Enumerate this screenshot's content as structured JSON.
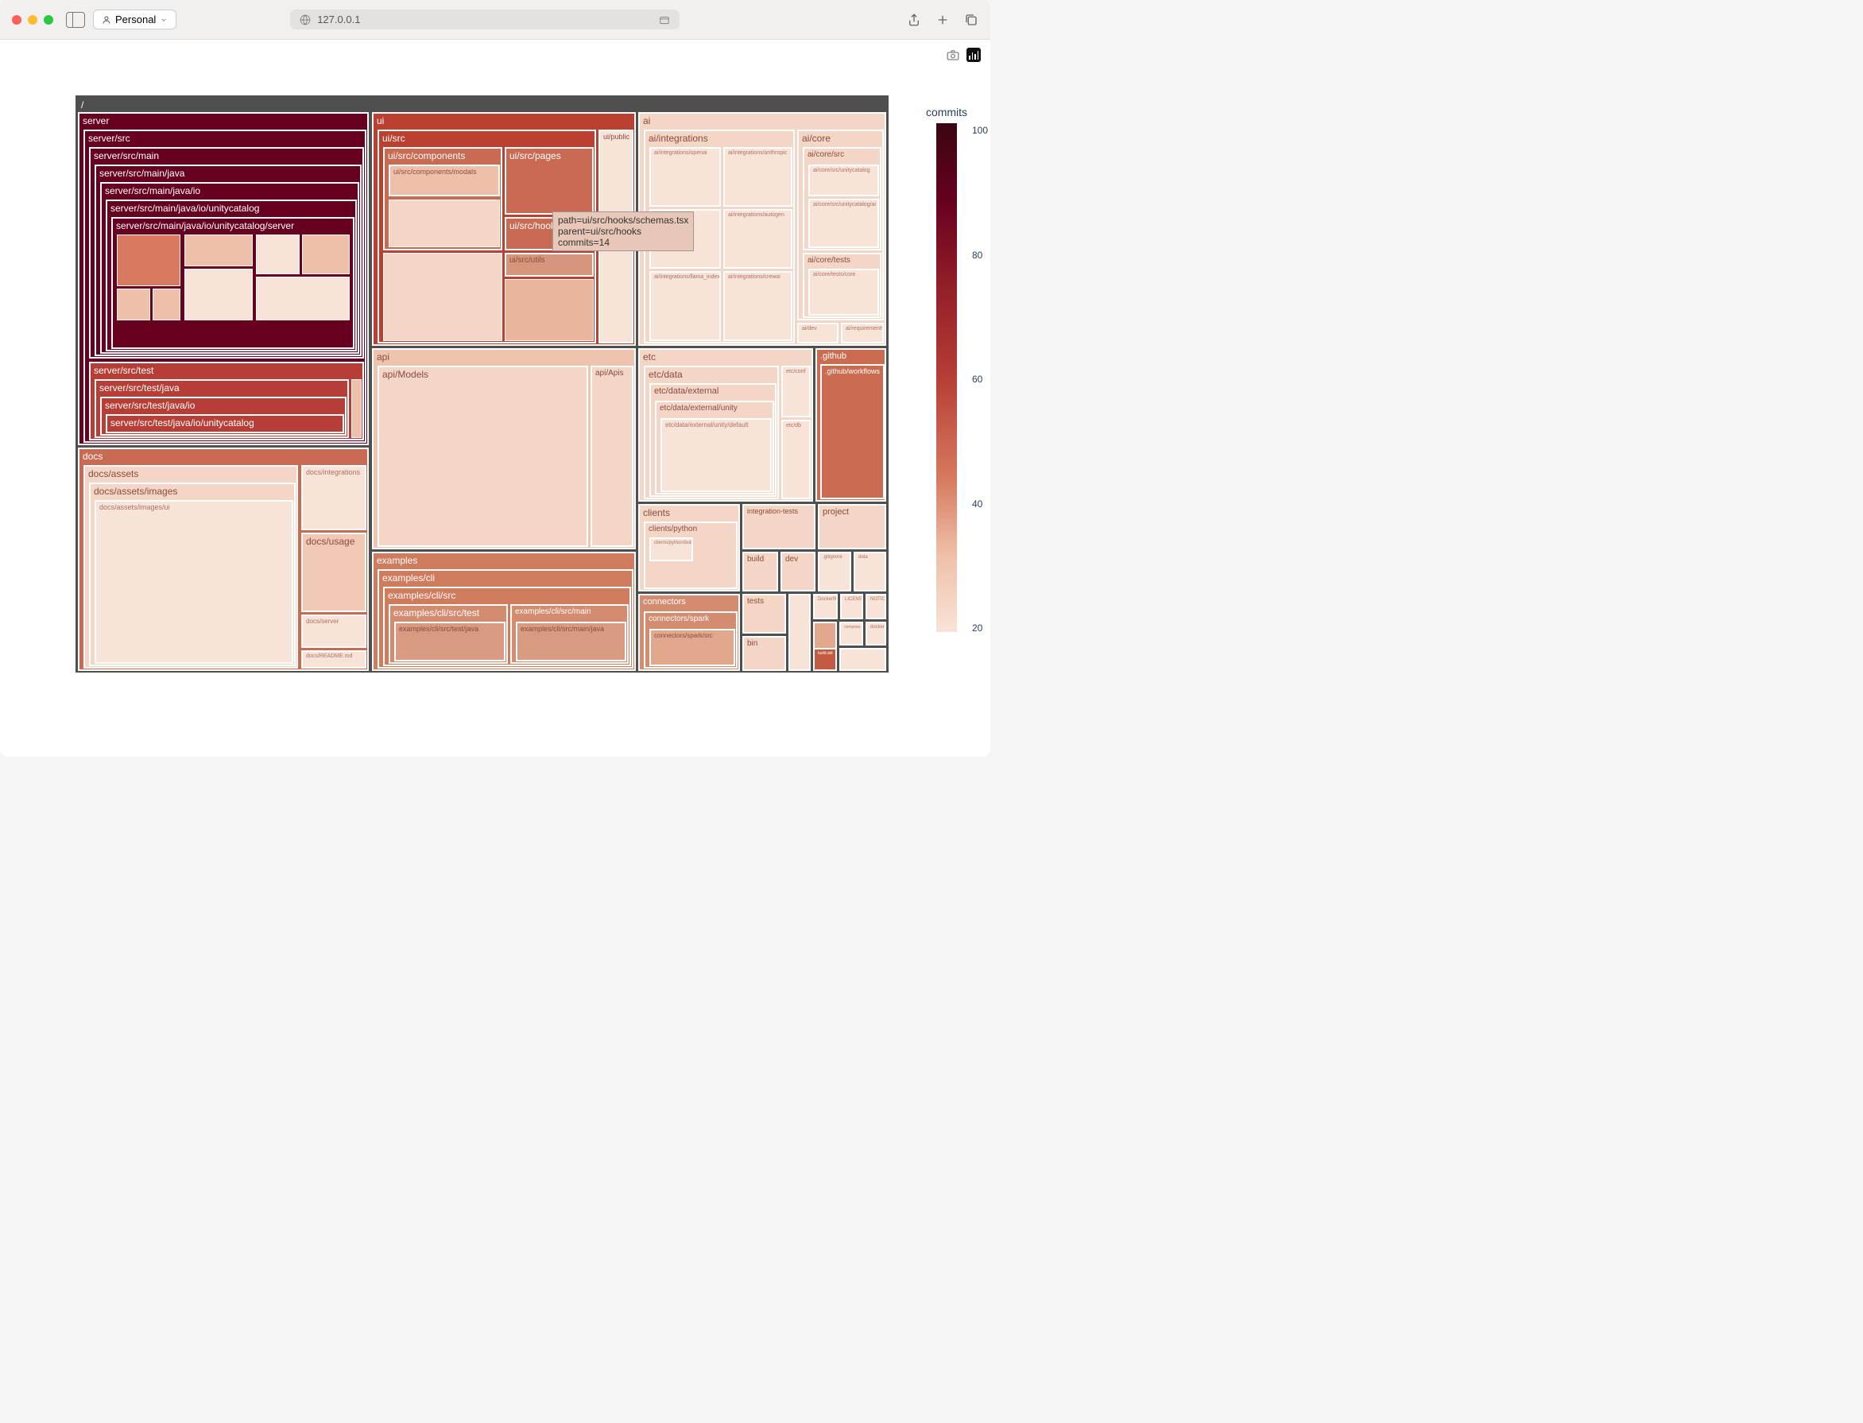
{
  "browser": {
    "profile_label": "Personal",
    "url": "127.0.0.1"
  },
  "colorbar": {
    "title": "commits",
    "ticks": [
      "100",
      "80",
      "60",
      "40",
      "20"
    ]
  },
  "root": "/",
  "tooltip": {
    "line1": "path=ui/src/hooks/schemas.tsx",
    "line2": "parent=ui/src/hooks",
    "line3": "commits=14"
  },
  "chart_data": {
    "type": "treemap",
    "title": "",
    "value_field": "commits",
    "color_field": "commits",
    "color_range": [
      0,
      100
    ],
    "hover": {
      "path": "ui/src/hooks/schemas.tsx",
      "parent": "ui/src/hooks",
      "commits": 14
    },
    "tree": {
      "name": "/",
      "children": [
        {
          "name": "server",
          "commits": 95,
          "children": [
            {
              "name": "server/src",
              "commits": 95,
              "children": [
                {
                  "name": "server/src/main",
                  "commits": 95,
                  "children": [
                    {
                      "name": "server/src/main/java",
                      "commits": 95,
                      "children": [
                        {
                          "name": "server/src/main/java/io",
                          "commits": 95,
                          "children": [
                            {
                              "name": "server/src/main/java/io/unitycatalog",
                              "commits": 95,
                              "children": [
                                {
                                  "name": "server/src/main/java/io/unitycatalog/server",
                                  "commits": 95
                                }
                              ]
                            }
                          ]
                        }
                      ]
                    }
                  ]
                },
                {
                  "name": "server/src/test",
                  "commits": 55,
                  "children": [
                    {
                      "name": "server/src/test/java",
                      "commits": 55,
                      "children": [
                        {
                          "name": "server/src/test/java/io",
                          "commits": 55,
                          "children": [
                            {
                              "name": "server/src/test/java/io/unitycatalog",
                              "commits": 55
                            }
                          ]
                        }
                      ]
                    }
                  ]
                }
              ]
            }
          ]
        },
        {
          "name": "docs",
          "commits": 25,
          "children": [
            {
              "name": "docs/assets",
              "commits": 15,
              "children": [
                {
                  "name": "docs/assets/images",
                  "commits": 15,
                  "children": [
                    {
                      "name": "docs/assets/images/ui",
                      "commits": 12
                    }
                  ]
                }
              ]
            },
            {
              "name": "docs/integrations",
              "commits": 12
            },
            {
              "name": "docs/usage",
              "commits": 18
            },
            {
              "name": "docs/server",
              "commits": 10
            },
            {
              "name": "docs/README.md",
              "commits": 8
            }
          ]
        },
        {
          "name": "ui",
          "commits": 55,
          "children": [
            {
              "name": "ui/src",
              "commits": 55,
              "children": [
                {
                  "name": "ui/src/components",
                  "commits": 50,
                  "children": [
                    {
                      "name": "ui/src/components/modals",
                      "commits": 30
                    }
                  ]
                },
                {
                  "name": "ui/src/pages",
                  "commits": 45
                },
                {
                  "name": "ui/src/hooks",
                  "commits": 50,
                  "children": [
                    {
                      "name": "ui/src/hooks/schemas.tsx",
                      "commits": 14
                    }
                  ]
                },
                {
                  "name": "ui/src/utils",
                  "commits": 40
                }
              ]
            },
            {
              "name": "ui/public",
              "commits": 15
            }
          ]
        },
        {
          "name": "api",
          "commits": 20,
          "children": [
            {
              "name": "api/Models",
              "commits": 18
            },
            {
              "name": "api/Apis",
              "commits": 15
            }
          ]
        },
        {
          "name": "examples",
          "commits": 40,
          "children": [
            {
              "name": "examples/cli",
              "commits": 40,
              "children": [
                {
                  "name": "examples/cli/src",
                  "commits": 40,
                  "children": [
                    {
                      "name": "examples/cli/src/test",
                      "commits": 38,
                      "children": [
                        {
                          "name": "examples/cli/src/test/java",
                          "commits": 35
                        }
                      ]
                    },
                    {
                      "name": "examples/cli/src/main",
                      "commits": 38,
                      "children": [
                        {
                          "name": "examples/cli/src/main/java",
                          "commits": 35
                        }
                      ]
                    }
                  ]
                }
              ]
            }
          ]
        },
        {
          "name": "ai",
          "commits": 15,
          "children": [
            {
              "name": "ai/integrations",
              "commits": 15,
              "children": [
                {
                  "name": "ai/integrations/openai",
                  "commits": 12
                },
                {
                  "name": "ai/integrations/anthropic",
                  "commits": 12
                },
                {
                  "name": "ai/integrations/langchain",
                  "commits": 12
                },
                {
                  "name": "ai/integrations/autogen",
                  "commits": 10
                },
                {
                  "name": "ai/integrations/llama_index",
                  "commits": 10
                },
                {
                  "name": "ai/integrations/crewai",
                  "commits": 10
                }
              ]
            },
            {
              "name": "ai/core",
              "commits": 15,
              "children": [
                {
                  "name": "ai/core/src",
                  "commits": 15,
                  "children": [
                    {
                      "name": "ai/core/src/unitycatalog",
                      "commits": 14
                    },
                    {
                      "name": "ai/core/src/unitycatalog/ai",
                      "commits": 13
                    }
                  ]
                },
                {
                  "name": "ai/core/tests",
                  "commits": 13,
                  "children": [
                    {
                      "name": "ai/core/tests/core",
                      "commits": 12
                    }
                  ]
                }
              ]
            },
            {
              "name": "ai/dev",
              "commits": 10
            },
            {
              "name": "ai/requirements",
              "commits": 10
            }
          ]
        },
        {
          "name": "etc",
          "commits": 15,
          "children": [
            {
              "name": "etc/data",
              "commits": 14,
              "children": [
                {
                  "name": "etc/data/external",
                  "commits": 14,
                  "children": [
                    {
                      "name": "etc/data/external/unity",
                      "commits": 13,
                      "children": [
                        {
                          "name": "etc/data/external/unity/default",
                          "commits": 12
                        }
                      ]
                    }
                  ]
                }
              ]
            },
            {
              "name": "etc/conf",
              "commits": 12
            },
            {
              "name": "etc/db",
              "commits": 12
            }
          ]
        },
        {
          "name": ".github",
          "commits": 40,
          "children": [
            {
              "name": ".github/workflows",
              "commits": 40
            }
          ]
        },
        {
          "name": "clients",
          "commits": 15,
          "children": [
            {
              "name": "clients/python",
              "commits": 14,
              "children": [
                {
                  "name": "clients/python/build",
                  "commits": 12
                }
              ]
            }
          ]
        },
        {
          "name": "integration-tests",
          "commits": 14
        },
        {
          "name": "project",
          "commits": 15
        },
        {
          "name": "connectors",
          "commits": 35,
          "children": [
            {
              "name": "connectors/spark",
              "commits": 35,
              "children": [
                {
                  "name": "connectors/spark/src",
                  "commits": 30
                }
              ]
            }
          ]
        },
        {
          "name": "build",
          "commits": 15
        },
        {
          "name": "dev",
          "commits": 15
        },
        {
          "name": "tests",
          "commits": 15
        },
        {
          "name": "bin",
          "commits": 14
        },
        {
          "name": "Dockerfile",
          "commits": 12
        },
        {
          "name": "LICENSE",
          "commits": 10
        },
        {
          "name": "NOTICE",
          "commits": 10
        },
        {
          "name": "docker",
          "commits": 12
        },
        {
          "name": "build.sbt",
          "commits": 50
        },
        {
          "name": "compose.yaml",
          "commits": 12
        },
        {
          "name": "gitignore",
          "commits": 12
        },
        {
          "name": "data",
          "commits": 12
        }
      ]
    }
  },
  "labels": {
    "server": "server",
    "server_src": "server/src",
    "server_src_main": "server/src/main",
    "server_src_main_java": "server/src/main/java",
    "server_src_main_java_io": "server/src/main/java/io",
    "server_src_main_java_io_uc": "server/src/main/java/io/unitycatalog",
    "server_src_main_java_io_uc_server": "server/src/main/java/io/unitycatalog/server",
    "server_src_test": "server/src/test",
    "server_src_test_java": "server/src/test/java",
    "server_src_test_java_io": "server/src/test/java/io",
    "server_src_test_java_io_uc": "server/src/test/java/io/unitycatalog",
    "docs": "docs",
    "docs_assets": "docs/assets",
    "docs_assets_images": "docs/assets/images",
    "docs_assets_images_ui": "docs/assets/images/ui",
    "docs_integrations": "docs/integrations",
    "docs_usage": "docs/usage",
    "docs_server": "docs/server",
    "docs_readme": "docs/README.md",
    "ui": "ui",
    "ui_src": "ui/src",
    "ui_src_components": "ui/src/components",
    "ui_src_components_modals": "ui/src/components/modals",
    "ui_src_pages": "ui/src/pages",
    "ui_src_hooks": "ui/src/hooks",
    "ui_src_utils": "ui/src/utils",
    "ui_public": "ui/public",
    "api": "api",
    "api_models": "api/Models",
    "api_apis": "api/Apis",
    "examples": "examples",
    "examples_cli": "examples/cli",
    "examples_cli_src": "examples/cli/src",
    "examples_cli_src_test": "examples/cli/src/test",
    "examples_cli_src_test_java": "examples/cli/src/test/java",
    "examples_cli_src_main": "examples/cli/src/main",
    "examples_cli_src_main_java": "examples/cli/src/main/java",
    "ai": "ai",
    "ai_integrations": "ai/integrations",
    "ai_int_openai": "ai/integrations/openai",
    "ai_int_anthropic": "ai/integrations/anthropic",
    "ai_int_langchain": "ai/integrations/langchain",
    "ai_int_autogen": "ai/integrations/autogen",
    "ai_int_llama": "ai/integrations/llama_index",
    "ai_int_crewai": "ai/integrations/crewai",
    "ai_core": "ai/core",
    "ai_core_src": "ai/core/src",
    "ai_core_src_uc": "ai/core/src/unitycatalog",
    "ai_core_src_uc_ai": "ai/core/src/unitycatalog/ai",
    "ai_core_tests": "ai/core/tests",
    "ai_core_tests_core": "ai/core/tests/core",
    "ai_dev": "ai/dev",
    "ai_req": "ai/requirements",
    "etc": "etc",
    "etc_data": "etc/data",
    "etc_data_ext": "etc/data/external",
    "etc_data_ext_unity": "etc/data/external/unity",
    "etc_data_ext_unity_def": "etc/data/external/unity/default",
    "etc_conf": "etc/conf",
    "etc_db": "etc/db",
    "github": ".github",
    "github_wf": ".github/workflows",
    "clients": "clients",
    "clients_python": "clients/python",
    "clients_python_build": "clients/python/build",
    "integration_tests": "integration-tests",
    "project": "project",
    "connectors": "connectors",
    "connectors_spark": "connectors/spark",
    "connectors_spark_src": "connectors/spark/src",
    "build": "build",
    "dev": "dev",
    "tests": "tests",
    "bin": "bin",
    "dockerfile": "Dockerfile",
    "license": "LICENSE",
    "notice": "NOTICE",
    "docker": "docker",
    "build_sbt": "build.sbt",
    "compose_yaml": "compose.yaml",
    "gitignore": ".gitignore",
    "data_box": "data"
  }
}
